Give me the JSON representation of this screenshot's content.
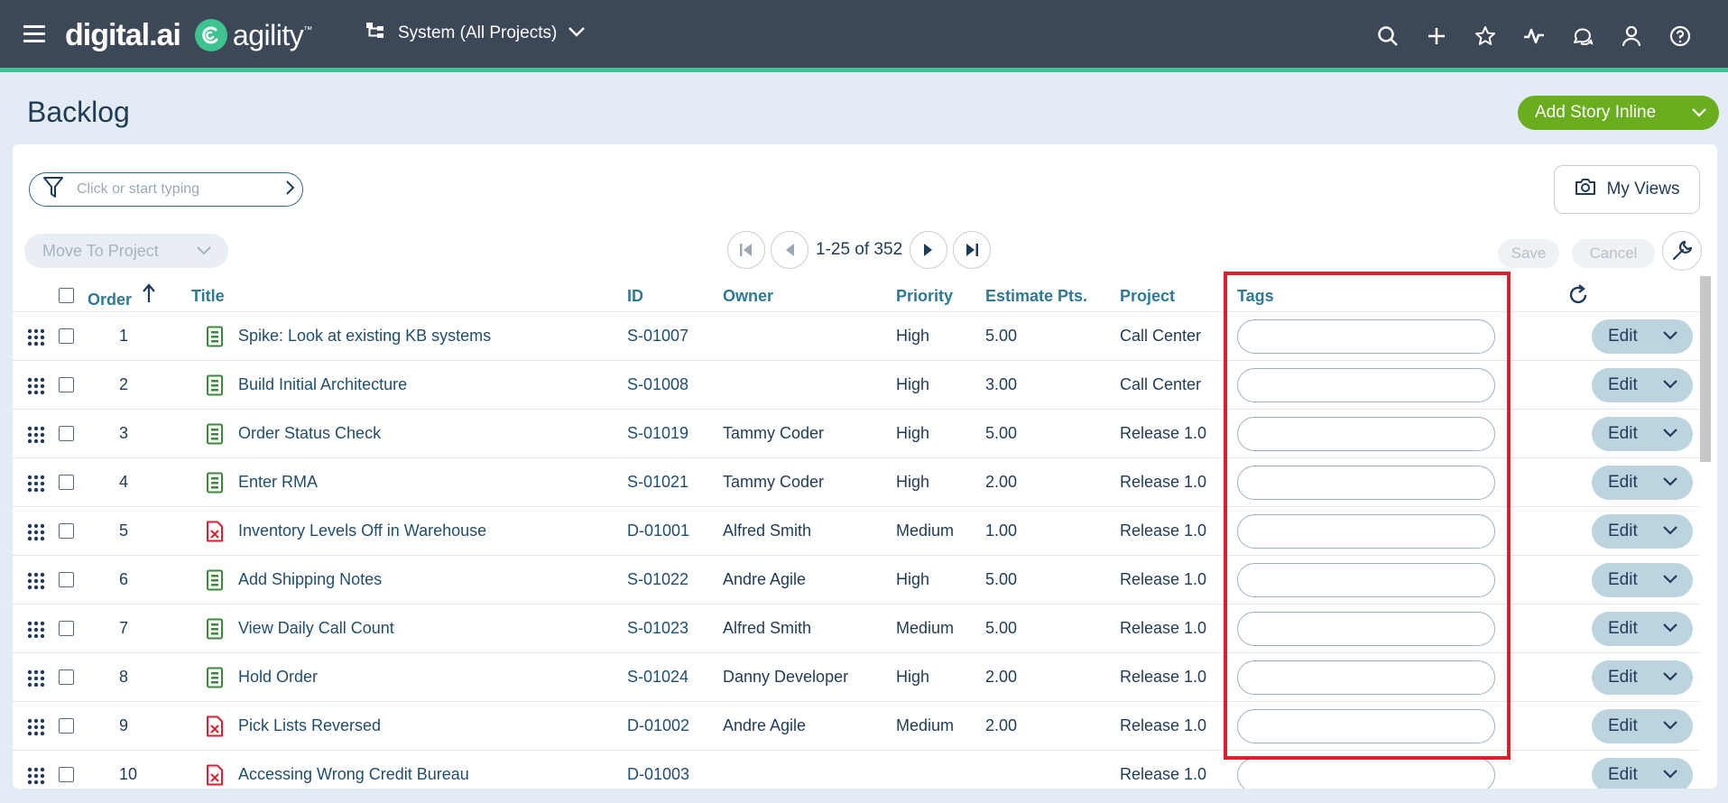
{
  "topbar": {
    "brand_digital": "digital.ai",
    "brand_agility": "agility",
    "brand_tm": "™",
    "project_selector": "System (All Projects)",
    "icons": [
      "search-icon",
      "plus-icon",
      "star-icon",
      "activity-icon",
      "chat-icon",
      "user-icon",
      "help-icon"
    ]
  },
  "page": {
    "title": "Backlog",
    "add_story_label": "Add Story Inline"
  },
  "toolbar": {
    "filter_placeholder": "Click or start typing",
    "my_views_label": "My Views",
    "move_to_project_label": "Move To Project",
    "pagination_range": "1-25 of 352",
    "save_label": "Save",
    "cancel_label": "Cancel"
  },
  "grid": {
    "columns": {
      "order": "Order",
      "title": "Title",
      "id": "ID",
      "owner": "Owner",
      "priority": "Priority",
      "estimate": "Estimate Pts.",
      "project": "Project",
      "tags": "Tags"
    },
    "edit_label": "Edit",
    "rows": [
      {
        "order": "1",
        "type": "story",
        "title": "Spike: Look at existing KB systems",
        "id": "S-01007",
        "owner": "",
        "priority": "High",
        "estimate": "5.00",
        "project": "Call Center"
      },
      {
        "order": "2",
        "type": "story",
        "title": "Build Initial Architecture",
        "id": "S-01008",
        "owner": "",
        "priority": "High",
        "estimate": "3.00",
        "project": "Call Center"
      },
      {
        "order": "3",
        "type": "story",
        "title": "Order Status Check",
        "id": "S-01019",
        "owner": "Tammy Coder",
        "priority": "High",
        "estimate": "5.00",
        "project": "Release 1.0"
      },
      {
        "order": "4",
        "type": "story",
        "title": "Enter RMA",
        "id": "S-01021",
        "owner": "Tammy Coder",
        "priority": "High",
        "estimate": "2.00",
        "project": "Release 1.0"
      },
      {
        "order": "5",
        "type": "defect",
        "title": "Inventory Levels Off in Warehouse",
        "id": "D-01001",
        "owner": "Alfred Smith",
        "priority": "Medium",
        "estimate": "1.00",
        "project": "Release 1.0"
      },
      {
        "order": "6",
        "type": "story",
        "title": "Add Shipping Notes",
        "id": "S-01022",
        "owner": "Andre Agile",
        "priority": "High",
        "estimate": "5.00",
        "project": "Release 1.0"
      },
      {
        "order": "7",
        "type": "story",
        "title": "View Daily Call Count",
        "id": "S-01023",
        "owner": "Alfred Smith",
        "priority": "Medium",
        "estimate": "5.00",
        "project": "Release 1.0"
      },
      {
        "order": "8",
        "type": "story",
        "title": "Hold Order",
        "id": "S-01024",
        "owner": "Danny Developer",
        "priority": "High",
        "estimate": "2.00",
        "project": "Release 1.0"
      },
      {
        "order": "9",
        "type": "defect",
        "title": "Pick Lists Reversed",
        "id": "D-01002",
        "owner": "Andre Agile",
        "priority": "Medium",
        "estimate": "2.00",
        "project": "Release 1.0"
      },
      {
        "order": "10",
        "type": "defect",
        "title": "Accessing Wrong Credit Bureau",
        "id": "D-01003",
        "owner": "",
        "priority": "",
        "estimate": "",
        "project": "Release 1.0"
      }
    ]
  },
  "colors": {
    "topbar": "#3c4858",
    "accent_green": "#3ec28f",
    "add_button": "#6aad1e",
    "story_icon": "#3a8a3a",
    "defect_icon": "#d9202e",
    "highlight": "#d9202e"
  }
}
